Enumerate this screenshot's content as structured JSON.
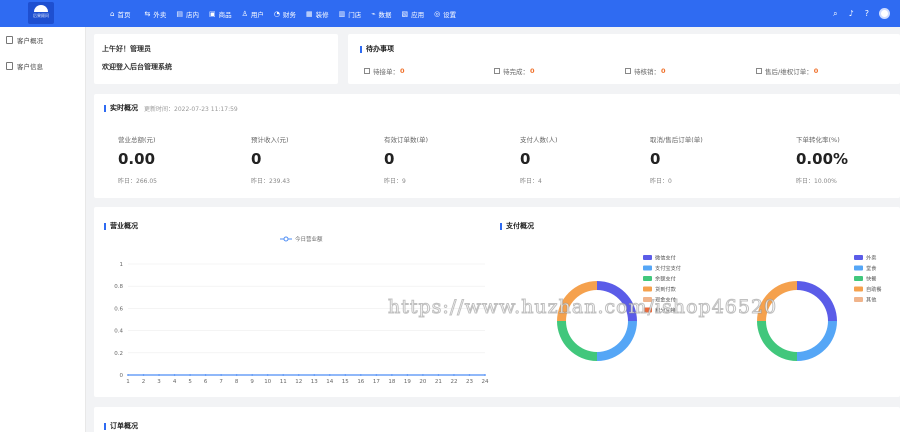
{
  "brand": {
    "logo_text": "后果顾问"
  },
  "nav": {
    "items": [
      {
        "label": "首页",
        "icon": "home-icon",
        "glyph": "⌂"
      },
      {
        "label": "外卖",
        "icon": "takeout-icon",
        "glyph": "⇆"
      },
      {
        "label": "店内",
        "icon": "store-icon",
        "glyph": "▤"
      },
      {
        "label": "商品",
        "icon": "goods-icon",
        "glyph": "▣"
      },
      {
        "label": "用户",
        "icon": "user-icon",
        "glyph": "♙"
      },
      {
        "label": "财务",
        "icon": "finance-icon",
        "glyph": "◔"
      },
      {
        "label": "装修",
        "icon": "decor-icon",
        "glyph": "▦"
      },
      {
        "label": "门店",
        "icon": "shop-icon",
        "glyph": "▥"
      },
      {
        "label": "数据",
        "icon": "data-icon",
        "glyph": "⌁"
      },
      {
        "label": "应用",
        "icon": "apps-icon",
        "glyph": "▧"
      },
      {
        "label": "设置",
        "icon": "settings-icon",
        "glyph": "◎"
      }
    ]
  },
  "sidebar": {
    "items": [
      {
        "label": "客户概况"
      },
      {
        "label": "客户信息"
      }
    ]
  },
  "greeting": {
    "line1": "上午好！管理员",
    "line2": "欢迎登入后台管理系统"
  },
  "todo": {
    "title": "待办事项",
    "items": [
      {
        "label": "待接单：",
        "count": "0"
      },
      {
        "label": "待完成：",
        "count": "0"
      },
      {
        "label": "待核销：",
        "count": "0"
      },
      {
        "label": "售后/维权订单：",
        "count": "0"
      }
    ]
  },
  "realtime": {
    "title": "实时概况",
    "updated": "更新时间：2022-07-23 11:17:59",
    "metrics": [
      {
        "label": "营业总额(元)",
        "value": "0.00",
        "yesterday": "昨日：266.05"
      },
      {
        "label": "预计收入(元)",
        "value": "0",
        "yesterday": "昨日：239.43"
      },
      {
        "label": "有效订单数(单)",
        "value": "0",
        "yesterday": "昨日：9"
      },
      {
        "label": "支付人数(人)",
        "value": "0",
        "yesterday": "昨日：4"
      },
      {
        "label": "取消/售后订单(单)",
        "value": "0",
        "yesterday": "昨日：0"
      },
      {
        "label": "下单转化率(%)",
        "value": "0.00%",
        "yesterday": "昨日：10.00%"
      }
    ]
  },
  "charts_section": {
    "business_title": "营业概况",
    "payment_title": "支付概况"
  },
  "orders_section": {
    "title": "订单概况"
  },
  "watermark": "https://www.huzhan.com/ishop46520",
  "colors": {
    "primary": "#2f6bf2",
    "accent_orange": "#f0702a"
  },
  "chart_data": [
    {
      "type": "line",
      "title": "营业概况",
      "series": [
        {
          "name": "今日营业额",
          "values": [
            0,
            0,
            0,
            0,
            0,
            0,
            0,
            0,
            0,
            0,
            0,
            0,
            0,
            0,
            0,
            0,
            0,
            0,
            0,
            0,
            0,
            0,
            0,
            0
          ]
        }
      ],
      "x": [
        "1",
        "2",
        "3",
        "4",
        "5",
        "6",
        "7",
        "8",
        "9",
        "10",
        "11",
        "12",
        "13",
        "14",
        "15",
        "16",
        "17",
        "18",
        "19",
        "20",
        "21",
        "22",
        "23",
        "24"
      ],
      "ylim": [
        0,
        1
      ],
      "yticks": [
        "0",
        "0.2",
        "0.4",
        "0.6",
        "0.8",
        "1"
      ],
      "grid": true,
      "legend": "top-center",
      "color": "#4e8df5"
    },
    {
      "type": "pie",
      "categories": [
        "微信支付",
        "支付宝支付",
        "余额支付",
        "货到付款",
        "现金支付",
        "积分兑换"
      ],
      "values": [
        25,
        25,
        25,
        25,
        0,
        0
      ],
      "colors": [
        "#5b5ce8",
        "#55a6f6",
        "#41c77c",
        "#f5a14d",
        "#f0b48b",
        "#ee6a3a"
      ],
      "legend": "left"
    },
    {
      "type": "pie",
      "categories": [
        "外卖",
        "堂食",
        "快餐",
        "自助餐",
        "其他"
      ],
      "values": [
        25,
        25,
        25,
        25,
        0
      ],
      "colors": [
        "#5b5ce8",
        "#55a6f6",
        "#41c77c",
        "#f5a14d",
        "#f0b48b"
      ],
      "legend": "top-right"
    }
  ]
}
